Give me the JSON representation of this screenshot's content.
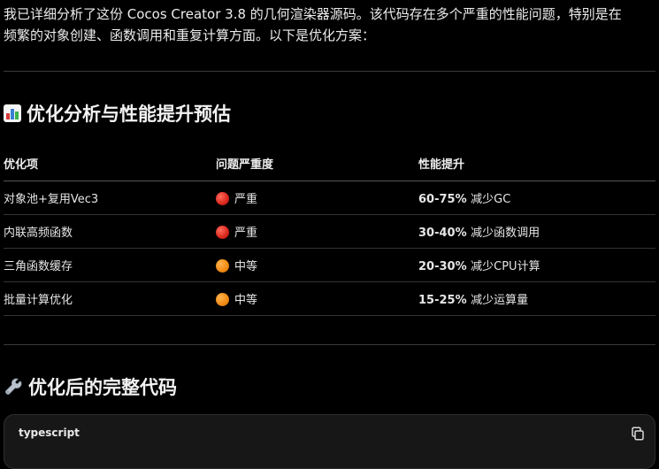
{
  "intro": {
    "line1": "我已详细分析了这份 Cocos Creator 3.8 的几何渲染器源码。该代码存在多个严重的性能问题，特别是在",
    "line2": "频繁的对象创建、函数调用和重复计算方面。以下是优化方案："
  },
  "section1": {
    "icon": "bar-chart-icon",
    "title": "优化分析与性能提升预估"
  },
  "table": {
    "headers": [
      "优化项",
      "问题严重度",
      "性能提升"
    ],
    "rows": [
      {
        "item": "对象池+复用Vec3",
        "severity": "严重",
        "severity_color": "red",
        "gain": "60-75%",
        "gain_desc": "减少GC"
      },
      {
        "item": "内联高频函数",
        "severity": "严重",
        "severity_color": "red",
        "gain": "30-40%",
        "gain_desc": "减少函数调用"
      },
      {
        "item": "三角函数缓存",
        "severity": "中等",
        "severity_color": "orange",
        "gain": "20-30%",
        "gain_desc": "减少CPU计算"
      },
      {
        "item": "批量计算优化",
        "severity": "中等",
        "severity_color": "orange",
        "gain": "15-25%",
        "gain_desc": "减少运算量"
      }
    ]
  },
  "section2": {
    "icon": "wrench-icon",
    "title": "优化后的完整代码"
  },
  "code_block": {
    "language": "typescript",
    "copy_icon": "copy-icon"
  }
}
